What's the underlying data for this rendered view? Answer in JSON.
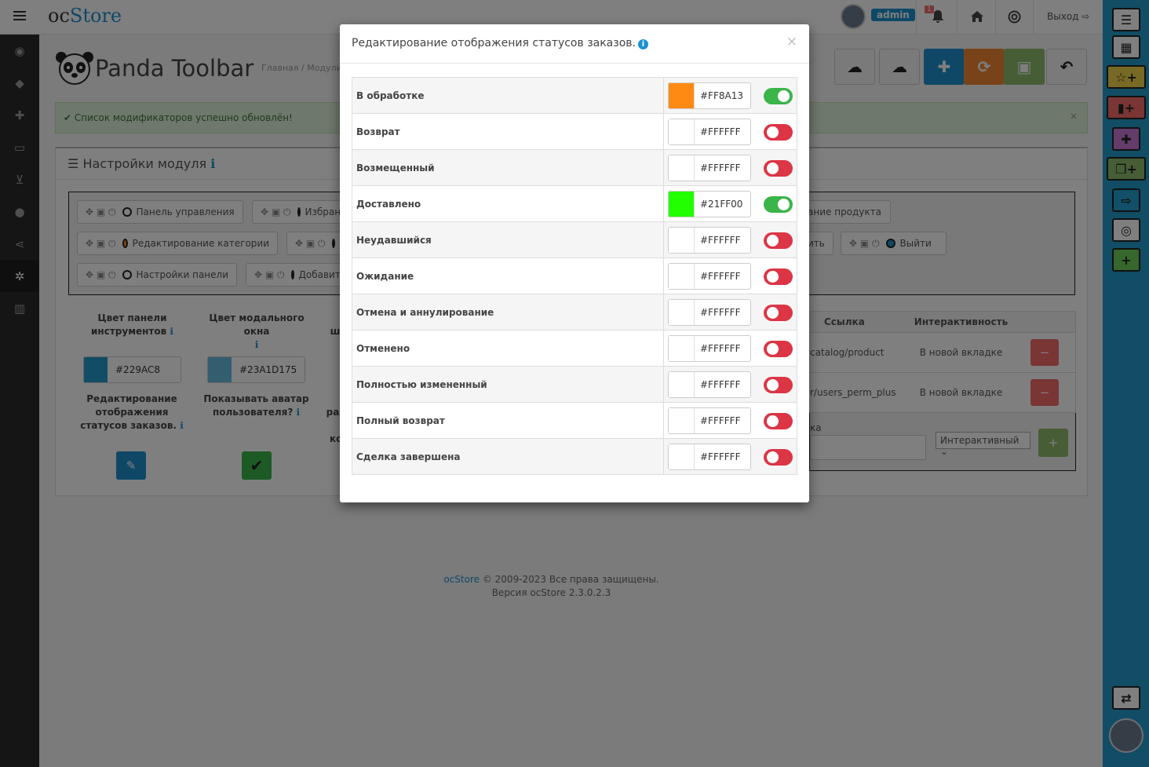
{
  "header": {
    "logo_part1": "oc",
    "logo_part2": "Store",
    "admin_label": "admin",
    "notification_count": "1",
    "logout_label": "Выход"
  },
  "page": {
    "title": "Panda Toolbar",
    "breadcrumb_home": "Главная",
    "breadcrumb_sep": "/",
    "breadcrumb_modules": "Модули",
    "alert_text": "Список модификаторов успешно обновлён!",
    "panel_title": "Настройки модуля",
    "pills": [
      {
        "label": "Панель управления",
        "dot": "#ffffff"
      },
      {
        "label": "Избранное",
        "dot": "#f1d54b"
      },
      {
        "label": "Редактирование категории",
        "dot": "#ff8a13"
      },
      {
        "label": "",
        "dot": "#ffffff"
      },
      {
        "label": "Настройки панели",
        "dot": "#ffffff"
      },
      {
        "label": "Добавить",
        "dot": "#3bb44a"
      },
      {
        "label": "ание продукта",
        "dot": ""
      },
      {
        "label": "ить",
        "dot": ""
      },
      {
        "label": "Выйти",
        "dot": "#1e91cf"
      }
    ],
    "settings": {
      "toolbar_color_label": "Цвет панели инструментов",
      "toolbar_color_value": "#229AC8",
      "modal_color_label": "Цвет модального окна",
      "modal_color_value": "#23A1D175",
      "third_label_fragment": "ш",
      "edit_status_label": "Редактирование отображения статусов заказов.",
      "avatar_label": "Показывать аватар пользователя?",
      "frag_ra": "ра",
      "frag_ko": "ко"
    },
    "links_table": {
      "col_link": "Ссылка",
      "col_interactivity": "Интерактивность",
      "rows": [
        {
          "link": "catalog/product",
          "mode": "В новой вкладке"
        },
        {
          "link": "r/users_perm_plus",
          "mode": "В новой вкладке"
        }
      ],
      "add_label_fragment": "ка",
      "select_value": "Интерактивный"
    },
    "footer_link": "ocStore",
    "footer_copy": "© 2009-2023 Все права защищены.",
    "footer_version": "Версия ocStore 2.3.0.2.3"
  },
  "modal": {
    "title": "Редактирование отображения статусов заказов.",
    "close_symbol": "×",
    "rows": [
      {
        "label": "В обработке",
        "hex": "#FF8A13",
        "color": "#ff8a13",
        "enabled": true
      },
      {
        "label": "Возврат",
        "hex": "#FFFFFF",
        "color": "#ffffff",
        "enabled": false
      },
      {
        "label": "Возмещенный",
        "hex": "#FFFFFF",
        "color": "#ffffff",
        "enabled": false
      },
      {
        "label": "Доставлено",
        "hex": "#21FF00",
        "color": "#21ff00",
        "enabled": true
      },
      {
        "label": "Неудавшийся",
        "hex": "#FFFFFF",
        "color": "#ffffff",
        "enabled": false
      },
      {
        "label": "Ожидание",
        "hex": "#FFFFFF",
        "color": "#ffffff",
        "enabled": false
      },
      {
        "label": "Отмена и аннулирование",
        "hex": "#FFFFFF",
        "color": "#ffffff",
        "enabled": false
      },
      {
        "label": "Отменено",
        "hex": "#FFFFFF",
        "color": "#ffffff",
        "enabled": false
      },
      {
        "label": "Полностью измененный",
        "hex": "#FFFFFF",
        "color": "#ffffff",
        "enabled": false
      },
      {
        "label": "Полный возврат",
        "hex": "#FFFFFF",
        "color": "#ffffff",
        "enabled": false
      },
      {
        "label": "Сделка завершена",
        "hex": "#FFFFFF",
        "color": "#ffffff",
        "enabled": false
      }
    ]
  },
  "colors": {
    "accent": "#229ac8",
    "toggle_on": "#3bb44a",
    "toggle_off": "#dc3545"
  }
}
